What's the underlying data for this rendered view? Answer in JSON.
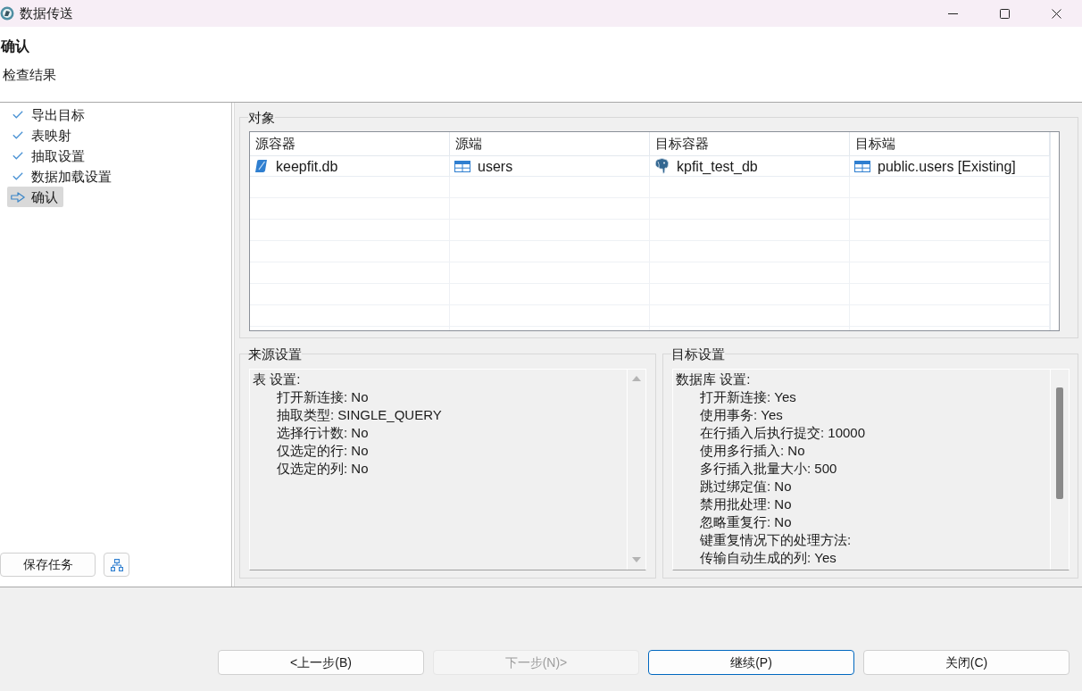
{
  "window": {
    "title": "数据传送"
  },
  "page_header": {
    "title": "确认",
    "subtitle": "检查结果"
  },
  "steps": [
    {
      "label": "导出目标",
      "completed": true,
      "selected": false
    },
    {
      "label": "表映射",
      "completed": true,
      "selected": false
    },
    {
      "label": "抽取设置",
      "completed": true,
      "selected": false
    },
    {
      "label": "数据加载设置",
      "completed": true,
      "selected": false
    },
    {
      "label": "确认",
      "completed": false,
      "selected": true
    }
  ],
  "sidebar_actions": {
    "save_task": "保存任务"
  },
  "objects": {
    "title": "对象",
    "table": {
      "columns": [
        "源容器",
        "源端",
        "目标容器",
        "目标端"
      ],
      "rows": [
        {
          "cells": [
            {
              "kind": "file",
              "text": "keepfit.db"
            },
            {
              "kind": "table",
              "text": "users"
            },
            {
              "kind": "database",
              "text": "kpfit_test_db"
            },
            {
              "kind": "table",
              "text": "public.users [Existing]"
            }
          ]
        }
      ]
    }
  },
  "source_settings": {
    "title": "来源设置",
    "heading": "表 设置:",
    "items": [
      "打开新连接: No",
      "抽取类型: SINGLE_QUERY",
      "选择行计数: No",
      "仅选定的行: No",
      "仅选定的列: No"
    ]
  },
  "target_settings": {
    "title": "目标设置",
    "heading": "数据库 设置:",
    "items": [
      "打开新连接: Yes",
      "使用事务: Yes",
      "在行插入后执行提交: 10000",
      "使用多行插入: No",
      "多行插入批量大小: 500",
      "跳过绑定值: No",
      "禁用批处理: No",
      "忽略重复行: No",
      "键重复情况下的处理方法:",
      "传输自动生成的列: Yes"
    ]
  },
  "buttons": [
    {
      "label": "<上一步(B)",
      "disabled": false,
      "default": false
    },
    {
      "label": "下一步(N)>",
      "disabled": true,
      "default": false
    },
    {
      "label": "继续(P)",
      "disabled": false,
      "default": true
    },
    {
      "label": "关闭(C)",
      "disabled": false,
      "default": false
    }
  ]
}
